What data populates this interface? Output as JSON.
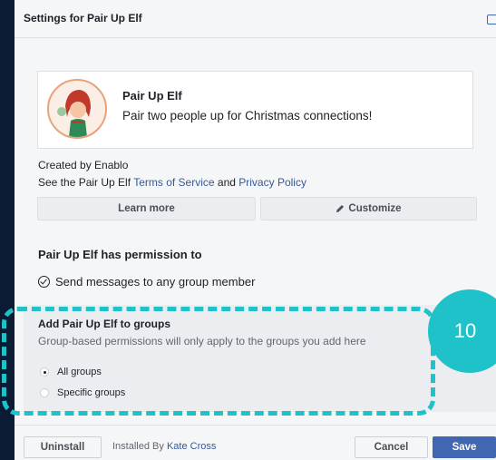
{
  "dialog": {
    "title": "Settings for Pair Up Elf"
  },
  "app": {
    "name": "Pair Up Elf",
    "description": "Pair two people up for Christmas connections!",
    "created_by": "Created by Enablo",
    "terms_prefix": "See the Pair Up Elf",
    "terms_link": "Terms of Service",
    "terms_and": "and",
    "privacy_link": "Privacy Policy"
  },
  "actions": {
    "learn_more": "Learn more",
    "customize": "Customize"
  },
  "permissions": {
    "title": "Pair Up Elf has permission to",
    "items": [
      "Send messages to any group member"
    ]
  },
  "groups": {
    "title": "Add Pair Up Elf to groups",
    "subtitle": "Group-based permissions will only apply to the groups you add here",
    "options": [
      {
        "label": "All groups",
        "selected": true
      },
      {
        "label": "Specific groups",
        "selected": false
      }
    ]
  },
  "footer": {
    "uninstall": "Uninstall",
    "installed_by_prefix": "Installed By",
    "installed_by_name": "Kate Cross",
    "cancel": "Cancel",
    "save": "Save"
  },
  "annotation": {
    "step_number": "10",
    "color": "#1fc2c9"
  },
  "colors": {
    "accent": "#4267b2",
    "link": "#385898"
  },
  "icons": {
    "close": "close-icon",
    "pencil": "pencil-icon",
    "check": "check-circle-icon"
  }
}
